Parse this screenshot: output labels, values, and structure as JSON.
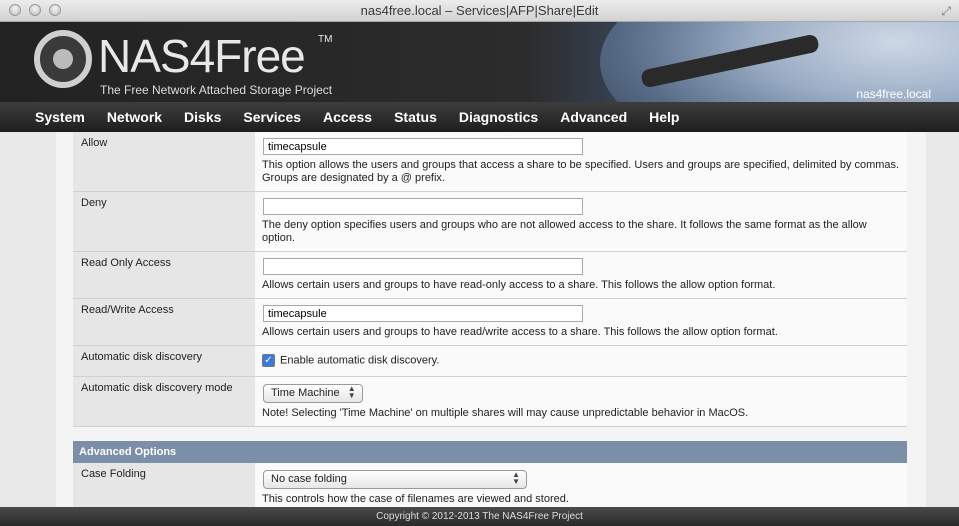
{
  "window": {
    "title": "nas4free.local – Services|AFP|Share|Edit"
  },
  "header": {
    "logo_text": "NAS4Free",
    "logo_tm": "TM",
    "subtitle": "The Free Network Attached Storage Project",
    "hostname": "nas4free.local"
  },
  "nav": [
    "System",
    "Network",
    "Disks",
    "Services",
    "Access",
    "Status",
    "Diagnostics",
    "Advanced",
    "Help"
  ],
  "form": {
    "allow": {
      "label": "Allow",
      "value": "timecapsule",
      "desc": "This option allows the users and groups that access a share to be specified. Users and groups are specified, delimited by commas. Groups are designated by a @ prefix."
    },
    "deny": {
      "label": "Deny",
      "value": "",
      "desc": "The deny option specifies users and groups who are not allowed access to the share. It follows the same format as the allow option."
    },
    "read_only": {
      "label": "Read Only Access",
      "value": "",
      "desc": "Allows certain users and groups to have read-only access to a share. This follows the allow option format."
    },
    "read_write": {
      "label": "Read/Write Access",
      "value": "timecapsule",
      "desc": "Allows certain users and groups to have read/write access to a share. This follows the allow option format."
    },
    "auto_discovery": {
      "label": "Automatic disk discovery",
      "checkbox_label": "Enable automatic disk discovery.",
      "checked": true
    },
    "auto_discovery_mode": {
      "label": "Automatic disk discovery mode",
      "selected": "Time Machine",
      "desc": "Note! Selecting 'Time Machine' on multiple shares will may cause unpredictable behavior in MacOS."
    },
    "advanced_heading": "Advanced Options",
    "case_folding": {
      "label": "Case Folding",
      "selected": "No case folding",
      "desc": "This controls how the case of filenames are viewed and stored."
    }
  },
  "footer": {
    "copyright": "Copyright © 2012-2013 The NAS4Free Project"
  }
}
